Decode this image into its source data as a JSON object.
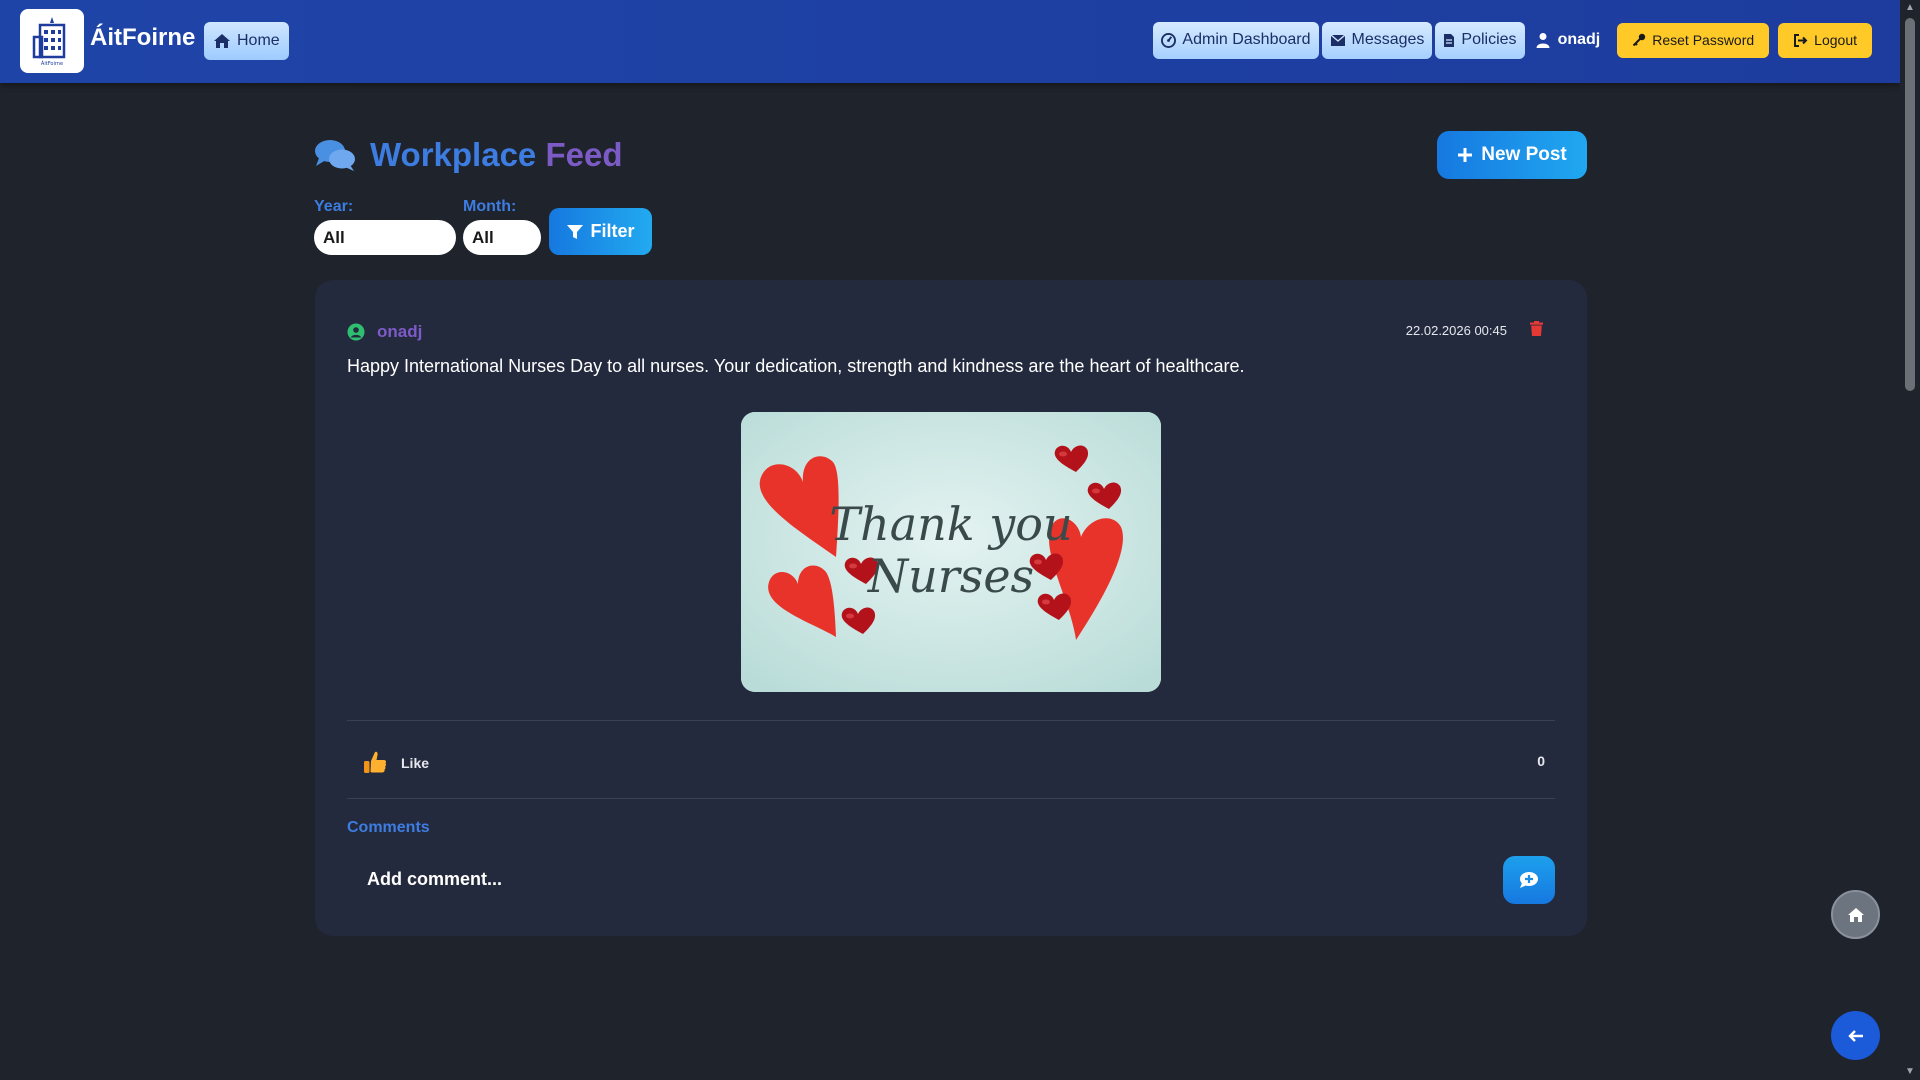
{
  "nav": {
    "brand": "ÁitFoirne",
    "logo_caption": "ÁitFoirne",
    "home": "Home",
    "admin_dashboard": "Admin Dashboard",
    "messages": "Messages",
    "policies": "Policies",
    "username": "onadj",
    "reset_password": "Reset Password",
    "logout": "Logout"
  },
  "header": {
    "title_part1": "Workplace",
    "title_part2": "Feed",
    "new_post": "New Post"
  },
  "filters": {
    "year_label": "Year:",
    "year_value": "All",
    "month_label": "Month:",
    "month_value": "All",
    "filter_button": "Filter"
  },
  "post": {
    "author": "onadj",
    "timestamp": "22.02.2026 00:45",
    "text": "Happy International Nurses Day to all nurses. Your dedication, strength and kindness are the heart of healthcare.",
    "image_text_line1": "Thank you",
    "image_text_line2": "Nurses",
    "like_label": "Like",
    "like_count": "0",
    "comments_label": "Comments",
    "comment_placeholder": "Add comment..."
  },
  "colors": {
    "navbar": "#1f44a8",
    "accent_blue": "#3d7ce0",
    "accent_purple": "#7d5bc7",
    "button_yellow": "#ffc928",
    "danger_red": "#e53935",
    "online_green": "#2fbf71",
    "card_bg": "#242a3d",
    "page_bg": "#1f232b"
  },
  "icons": {
    "logo": "building-icon",
    "home": "home-icon",
    "admin": "dashboard-icon",
    "messages": "envelope-icon",
    "policies": "document-icon",
    "user": "user-icon",
    "reset": "key-icon",
    "logout": "logout-icon",
    "title": "comments-icon",
    "new_post": "plus-icon",
    "filter": "filter-icon",
    "author": "user-circle-icon",
    "delete": "trash-icon",
    "like": "thumbs-up-icon",
    "send": "comment-send-icon",
    "fab_home": "home-icon",
    "fab_back": "arrow-left-icon"
  }
}
